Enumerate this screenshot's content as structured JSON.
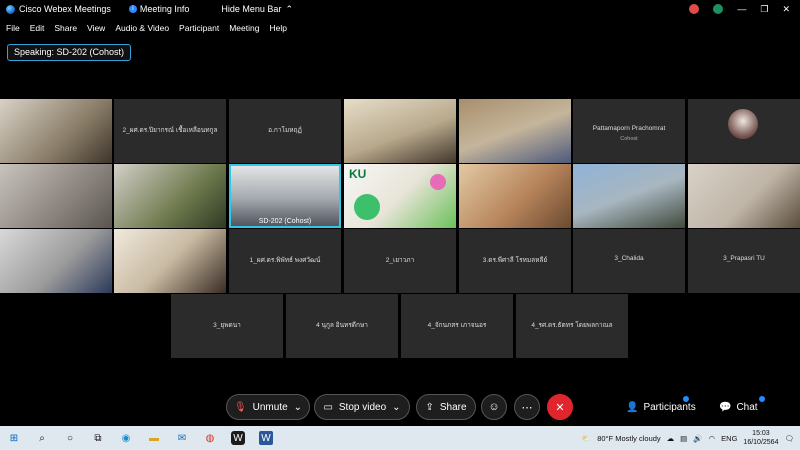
{
  "titlebar": {
    "app_title": "Cisco Webex Meetings",
    "meeting_info": "Meeting Info",
    "hide_menu": "Hide Menu Bar"
  },
  "menu": [
    "File",
    "Edit",
    "Share",
    "View",
    "Audio & Video",
    "Participant",
    "Meeting",
    "Help"
  ],
  "speaking_label": "Speaking: SD-202 (Cohost)",
  "tiles": {
    "r1": [
      {
        "name": "",
        "video": true
      },
      {
        "name": "2_ผศ.ดร.ปิยากรณ์ เชื้อเหลือนทกูล",
        "video": false
      },
      {
        "name": "อ.กาโมหฤฏ์",
        "video": false
      },
      {
        "name": "",
        "video": true
      },
      {
        "name": "",
        "video": true
      },
      {
        "name": "Pattamaporn Prachomrat",
        "sub": "Cohost",
        "video": false
      },
      {
        "name": "",
        "video": false,
        "avatar": true
      }
    ],
    "r2_host": "SD-202 (Cohost)",
    "r2_brand": "KU",
    "r3": [
      "1_ผศ.ดร.พิพัทธ์ พงศวัฒน์",
      "2_เยาวภา",
      "3.ดร.พีศาลี โรหมลหลีย์",
      "3_Chalida",
      "3_Prapasri TU"
    ],
    "r4": [
      "3_ยุพดนา",
      "4 นุกูล อินทรดีกษา",
      "4_จักนภสร เภาจนอร",
      "4_รศ.ดร.ธัตทร โดยพลกาณล"
    ]
  },
  "controls": {
    "unmute": "Unmute",
    "stop_video": "Stop video",
    "share": "Share",
    "participants": "Participants",
    "chat": "Chat"
  },
  "taskbar": {
    "weather": "80°F  Mostly cloudy",
    "lang": "ENG",
    "time": "15:03",
    "date": "16/10/2564"
  },
  "colors": {
    "end_button": "#e0262c",
    "active_speaker_border": "#33c6e6",
    "taskbar_bg": "#dfe7ef"
  }
}
